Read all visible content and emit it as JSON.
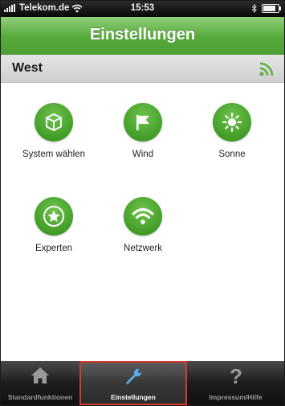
{
  "status_bar": {
    "carrier": "Telekom.de",
    "time": "15:53",
    "bluetooth_icon": "bluetooth-icon",
    "battery_level": 0.85
  },
  "nav": {
    "title": "Einstellungen"
  },
  "section": {
    "title": "West",
    "icon": "rss-icon"
  },
  "grid": [
    {
      "label": "System wählen",
      "icon": "cube-icon"
    },
    {
      "label": "Wind",
      "icon": "flag-icon"
    },
    {
      "label": "Sonne",
      "icon": "sun-icon"
    },
    {
      "label": "Experten",
      "icon": "star-icon"
    },
    {
      "label": "Netzwerk",
      "icon": "wifi-icon"
    }
  ],
  "tabs": [
    {
      "label": "Standardfunktionen",
      "icon": "home-icon"
    },
    {
      "label": "Einstellungen",
      "icon": "wrench-icon",
      "selected": true
    },
    {
      "label": "Impressum/Hilfe",
      "icon": "question-icon"
    }
  ],
  "colors": {
    "accent_green": "#57a93c",
    "selection_border": "#d33a2c"
  }
}
